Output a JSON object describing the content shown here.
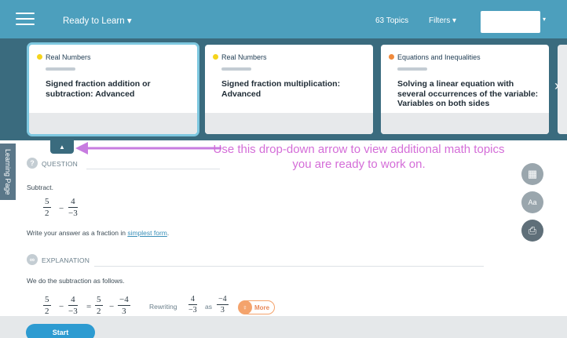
{
  "header": {
    "ready_label": "Ready to Learn ▾",
    "topics_count": "63 Topics",
    "filters_label": "Filters ▾",
    "user_caret": "▾"
  },
  "topic_cards": [
    {
      "category": "Real Numbers",
      "dot_color": "#f5d41c",
      "title": "Signed fraction addition or subtraction: Advanced"
    },
    {
      "category": "Real Numbers",
      "dot_color": "#f5d41c",
      "title": "Signed fraction multiplication: Advanced"
    },
    {
      "category": "Equations and Inequalities",
      "dot_color": "#f08a3c",
      "title": "Solving a linear equation with several occurrences of the variable: Variables on both sides"
    }
  ],
  "carousel": {
    "next_arrow": "›",
    "drop_arrow": "▲"
  },
  "annotation": {
    "text": "Use this drop-down arrow to view additional math topics you are ready to work on.",
    "color": "#d46dd8"
  },
  "learning_page_tab": "Learning Page",
  "question": {
    "heading": "QUESTION",
    "icon": "?",
    "prompt": "Subtract.",
    "instruction_before": "Write your answer as a fraction in ",
    "instruction_link": "simplest form",
    "instruction_after": "."
  },
  "explanation": {
    "heading": "EXPLANATION",
    "icon": "∞",
    "intro": "We do the subtraction as follows.",
    "rewriting_label": "Rewriting",
    "as_label": "as",
    "more_label": "More"
  },
  "math": {
    "f1_num": "5",
    "f1_den": "2",
    "minus": "−",
    "f2_num": "4",
    "f2_den": "−3",
    "equals": "=",
    "f3_num": "5",
    "f3_den": "2",
    "f4_num": "−4",
    "f4_den": "3",
    "r1_num": "4",
    "r1_den": "−3",
    "r2_num": "−4",
    "r2_den": "3"
  },
  "tools": {
    "calculator": "▦",
    "dictionary": "Aa",
    "print": "⎙"
  },
  "footer": {
    "start_label": "Start"
  },
  "colors": {
    "topbar": "#4c9fbd",
    "carousel": "#3a6b7e",
    "accent": "#2d9bd1",
    "more": "#f4a36c"
  }
}
